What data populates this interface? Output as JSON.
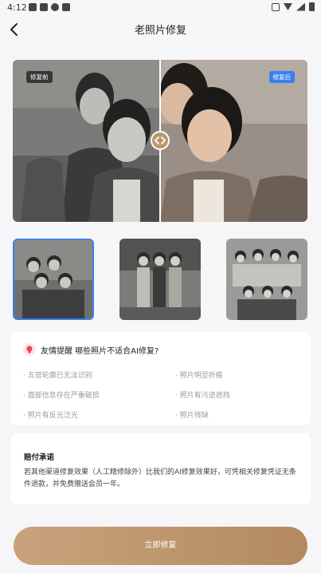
{
  "status_bar": {
    "time": "4:12",
    "left_icons": [
      "gallery-icon",
      "notification-icon",
      "message-icon",
      "app-icon"
    ],
    "right_icons": [
      "vibrate-icon",
      "wifi-icon",
      "signal-icon",
      "battery-icon"
    ]
  },
  "header": {
    "title": "老照片修复",
    "back_icon": "back-arrow-icon"
  },
  "compare": {
    "before_label": "修复前",
    "after_label": "修复后",
    "handle_icon": "left-right-arrows-icon"
  },
  "thumbnails": {
    "selected_index": 0,
    "count": 3
  },
  "tips": {
    "icon": "lightbulb-icon",
    "heading": "友情提醒 哪些照片不适合AI修复?",
    "items": [
      "· 五官轮廓已无法识别",
      "· 照片明显折痕",
      "· 面部信息存在严重破损",
      "· 照片有污迹遮挡",
      "· 照片有反光泛光",
      "· 照片残缺"
    ]
  },
  "promise": {
    "title": "赔付承诺",
    "body": "若其他渠道修复效果（人工精修除外）比我们的AI修复效果好，可凭相关修复凭证无条件退款，并免费赠送会员一年。"
  },
  "cta": {
    "label": "立即修复"
  },
  "colors": {
    "accent_gold": "#b9976d",
    "selected_blue": "#3a7ff0",
    "background": "#f6f6f8"
  }
}
